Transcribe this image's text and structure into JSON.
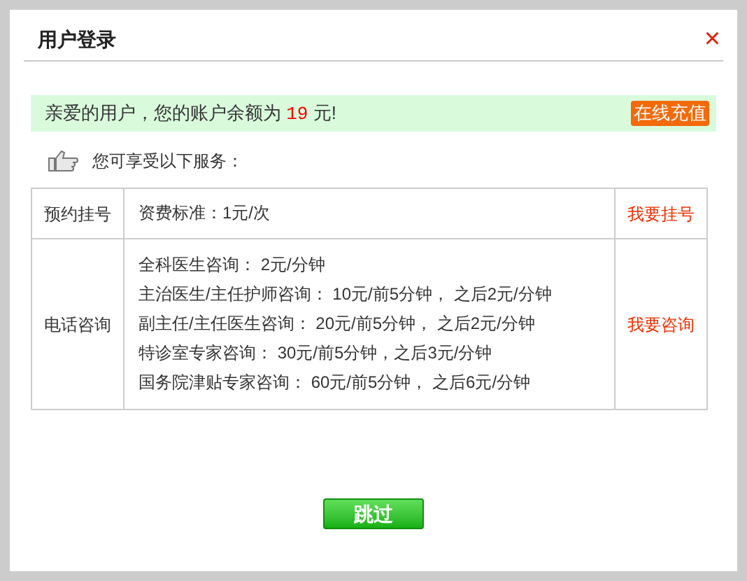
{
  "dialog": {
    "title": "用户登录",
    "close": "×"
  },
  "balance_banner": {
    "text_before": "亲爱的用户，您的账户余额为",
    "amount": "19",
    "text_after": "元!",
    "recharge_button": "在线充值"
  },
  "services_heading": "您可享受以下服务：",
  "services": [
    {
      "name": "预约挂号",
      "details": [
        "资费标准：1元/次"
      ],
      "action": "我要挂号"
    },
    {
      "name": "电话咨询",
      "details": [
        "全科医生咨询： 2元/分钟",
        "主治医生/主任护师咨询： 10元/前5分钟， 之后2元/分钟",
        "副主任/主任医生咨询： 20元/前5分钟， 之后2元/分钟",
        "特诊室专家咨询： 30元/前5分钟，之后3元/分钟",
        "国务院津贴专家咨询： 60元/前5分钟， 之后6元/分钟"
      ],
      "action": "我要咨询"
    }
  ],
  "skip_button": "跳过"
}
